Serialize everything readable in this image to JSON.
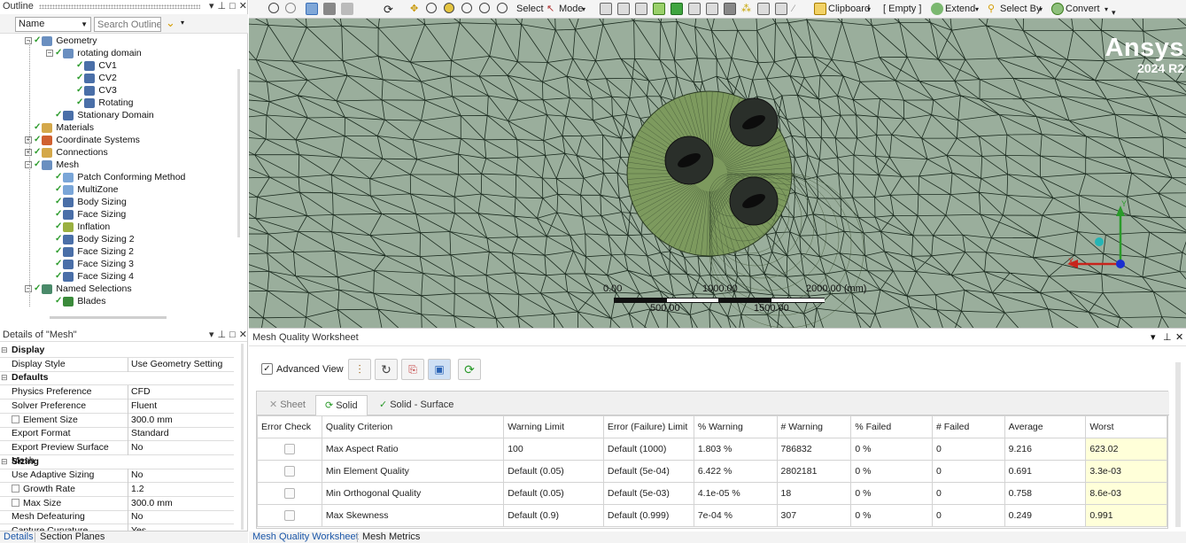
{
  "outline": {
    "title": "Outline",
    "name_select": "Name",
    "search_placeholder": "Search Outline",
    "tree": [
      {
        "label": "Geometry",
        "icon": "geometry-icon"
      },
      {
        "label": "rotating domain",
        "icon": "part-icon"
      },
      {
        "label": "CV1",
        "icon": "body-icon"
      },
      {
        "label": "CV2",
        "icon": "body-icon"
      },
      {
        "label": "CV3",
        "icon": "body-icon"
      },
      {
        "label": "Rotating",
        "icon": "body-icon"
      },
      {
        "label": "Stationary Domain",
        "icon": "body-icon"
      },
      {
        "label": "Materials",
        "icon": "materials-icon"
      },
      {
        "label": "Coordinate Systems",
        "icon": "coordinate-systems-icon"
      },
      {
        "label": "Connections",
        "icon": "connections-icon"
      },
      {
        "label": "Mesh",
        "icon": "mesh-icon"
      },
      {
        "label": "Patch Conforming Method",
        "icon": "method-icon"
      },
      {
        "label": "MultiZone",
        "icon": "method-icon"
      },
      {
        "label": "Body Sizing",
        "icon": "sizing-icon"
      },
      {
        "label": "Face Sizing",
        "icon": "sizing-icon"
      },
      {
        "label": "Inflation",
        "icon": "inflation-icon"
      },
      {
        "label": "Body Sizing 2",
        "icon": "sizing-icon"
      },
      {
        "label": "Face Sizing 2",
        "icon": "sizing-icon"
      },
      {
        "label": "Face Sizing 3",
        "icon": "sizing-icon"
      },
      {
        "label": "Face Sizing 4",
        "icon": "sizing-icon"
      },
      {
        "label": "Named Selections",
        "icon": "named-selections-icon"
      },
      {
        "label": "Blades",
        "icon": "selection-icon"
      }
    ]
  },
  "details": {
    "title": "Details of \"Mesh\"",
    "rows": [
      {
        "key": "Display",
        "section": true
      },
      {
        "key": "Display Style",
        "value": "Use Geometry Setting"
      },
      {
        "key": "Defaults",
        "section": true
      },
      {
        "key": "Physics Preference",
        "value": "CFD"
      },
      {
        "key": "Solver Preference",
        "value": "Fluent"
      },
      {
        "key": "Element Size",
        "value": "300.0 mm",
        "checkbox": true
      },
      {
        "key": "Export Format",
        "value": "Standard"
      },
      {
        "key": "Export Preview Surface Mesh",
        "value": "No"
      },
      {
        "key": "Sizing",
        "section": true
      },
      {
        "key": "Use Adaptive Sizing",
        "value": "No"
      },
      {
        "key": "Growth Rate",
        "value": "1.2",
        "checkbox": true
      },
      {
        "key": "Max Size",
        "value": "300.0 mm",
        "checkbox": true
      },
      {
        "key": "Mesh Defeaturing",
        "value": "No"
      },
      {
        "key": "Capture Curvature",
        "value": "Yes"
      }
    ],
    "tabs": [
      "Details",
      "Section Planes"
    ]
  },
  "toolbar": {
    "select": "Select",
    "mode": "Mode",
    "clipboard": "Clipboard",
    "empty": "[ Empty ]",
    "extend": "Extend",
    "select_by": "Select By",
    "convert": "Convert"
  },
  "viewport": {
    "brand": "Ansys",
    "version": "2024 R2",
    "scale_labels": [
      "0.00",
      "1000.00",
      "2000.00 (mm)",
      "500.00",
      "1500.00"
    ],
    "axes": {
      "x": "X",
      "y": "Y"
    },
    "colors": {
      "background": "#9aae9c",
      "refined": "#7d9a5e",
      "axis_x": "#c8241c",
      "axis_y": "#2a9a2a",
      "axis_z": "#1a2fd0"
    }
  },
  "worksheet": {
    "title": "Mesh Quality Worksheet",
    "advanced_view": "Advanced View",
    "advanced_view_checked": true,
    "tabs": [
      "Sheet",
      "Solid",
      "Solid - Surface"
    ],
    "active_tab": "Solid",
    "columns": [
      "Error Check",
      "Quality Criterion",
      "Warning Limit",
      "Error (Failure) Limit",
      "% Warning",
      "# Warning",
      "% Failed",
      "# Failed",
      "Average",
      "Worst"
    ],
    "rows": [
      [
        "",
        "Max Aspect Ratio",
        "100",
        "Default (1000)",
        "1.803 %",
        "786832",
        "0 %",
        "0",
        "9.216",
        "623.02"
      ],
      [
        "",
        "Min Element Quality",
        "Default (0.05)",
        "Default (5e-04)",
        "6.422 %",
        "2802181",
        "0 %",
        "0",
        "0.691",
        "3.3e-03"
      ],
      [
        "",
        "Min Orthogonal Quality",
        "Default (0.05)",
        "Default (5e-03)",
        "4.1e-05 %",
        "18",
        "0 %",
        "0",
        "0.758",
        "8.6e-03"
      ],
      [
        "",
        "Max Skewness",
        "Default (0.9)",
        "Default (0.999)",
        "7e-04 %",
        "307",
        "0 %",
        "0",
        "0.249",
        "0.991"
      ]
    ]
  },
  "bottom_tabs": [
    "Mesh Quality Worksheet",
    "Mesh Metrics"
  ]
}
